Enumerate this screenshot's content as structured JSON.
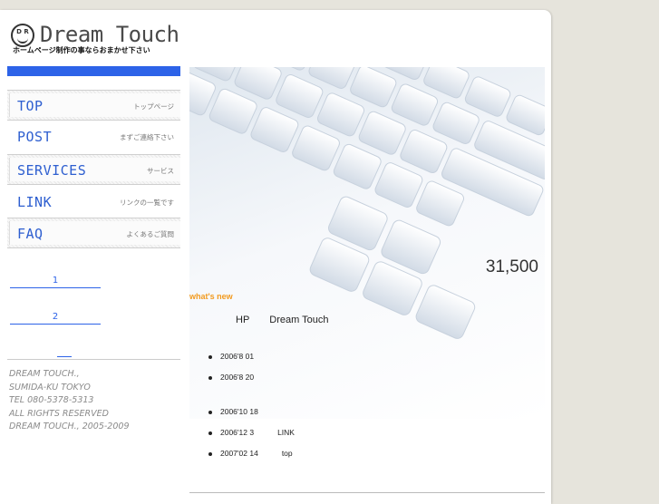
{
  "header": {
    "logo_mark": "D R",
    "logo_text": "Dream Touch",
    "tagline": "ホームページ制作の事ならおまかせ下さい"
  },
  "nav": {
    "items": [
      {
        "label": "TOP",
        "sub": "トップページ"
      },
      {
        "label": "POST",
        "sub": "まずご連絡下さい"
      },
      {
        "label": "SERVICES",
        "sub": "サービス"
      },
      {
        "label": "LINK",
        "sub": "リンクの一覧です"
      },
      {
        "label": "FAQ",
        "sub": "よくあるご質問"
      }
    ]
  },
  "side_links": [
    "1",
    "2"
  ],
  "address": {
    "line1": "DREAM TOUCH.,",
    "line2": "SUMIDA-KU TOKYO",
    "line3": "TEL 080-5378-5313",
    "line4": "ALL RIGHTS RESERVED",
    "line5": "DREAM TOUCH., 2005-2009"
  },
  "hero": {
    "price": "31,500"
  },
  "news": {
    "title": "what's new",
    "head_left": "HP",
    "head_right": "Dream Touch",
    "items": [
      {
        "date": "2006'8 01",
        "note": ""
      },
      {
        "date": "2006'8 20",
        "note": ""
      },
      {
        "date": "2006'10 18",
        "note": ""
      },
      {
        "date": "2006'12 3",
        "note": "LINK"
      },
      {
        "date": "2007'02 14",
        "note": "top"
      }
    ]
  },
  "colors": {
    "accent_blue": "#2d63e8",
    "orange": "#f29a1e",
    "background": "#e6e4dc"
  }
}
